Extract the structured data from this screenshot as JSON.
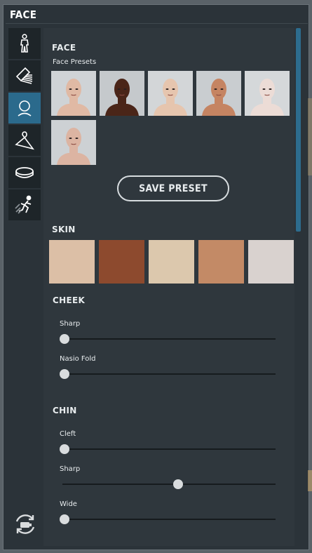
{
  "window": {
    "title": "FACE"
  },
  "sidebar": {
    "items": [
      {
        "name": "body",
        "icon": "body-figure-icon",
        "active": false
      },
      {
        "name": "hair",
        "icon": "comb-icon",
        "active": false
      },
      {
        "name": "face",
        "icon": "face-outline-icon",
        "active": true
      },
      {
        "name": "clothing",
        "icon": "hanger-icon",
        "active": false
      },
      {
        "name": "accessories",
        "icon": "ring-icon",
        "active": false
      },
      {
        "name": "animation",
        "icon": "running-figure-icon",
        "active": false
      }
    ],
    "reset_icon": "reset-camera-icon"
  },
  "face_section": {
    "heading": "FACE",
    "presets_label": "Face Presets",
    "presets": [
      {
        "skin": "#e0b9a4",
        "bg": "#cfd3d6"
      },
      {
        "skin": "#4a2518",
        "bg": "#c5c9cc"
      },
      {
        "skin": "#e6c5ae",
        "bg": "#d3d6d8"
      },
      {
        "skin": "#c58462",
        "bg": "#c9cdd0"
      },
      {
        "skin": "#ecdcd6",
        "bg": "#d5d8da"
      },
      {
        "skin": "#dcb4a2",
        "bg": "#cdd1d4"
      }
    ],
    "save_button": "SAVE PRESET"
  },
  "skin_section": {
    "heading": "SKIN",
    "swatches": [
      "#dcbfa6",
      "#8d4a2e",
      "#dcc8ad",
      "#c38a66",
      "#d9d2cf"
    ]
  },
  "cheek_section": {
    "heading": "CHEEK",
    "sliders": [
      {
        "label": "Sharp",
        "value": 0.0
      },
      {
        "label": "Nasio Fold",
        "value": 0.0
      }
    ]
  },
  "chin_section": {
    "heading": "CHIN",
    "sliders": [
      {
        "label": "Cleft",
        "value": 0.0
      },
      {
        "label": "Sharp",
        "value": 0.55
      },
      {
        "label": "Wide",
        "value": 0.0
      }
    ]
  }
}
